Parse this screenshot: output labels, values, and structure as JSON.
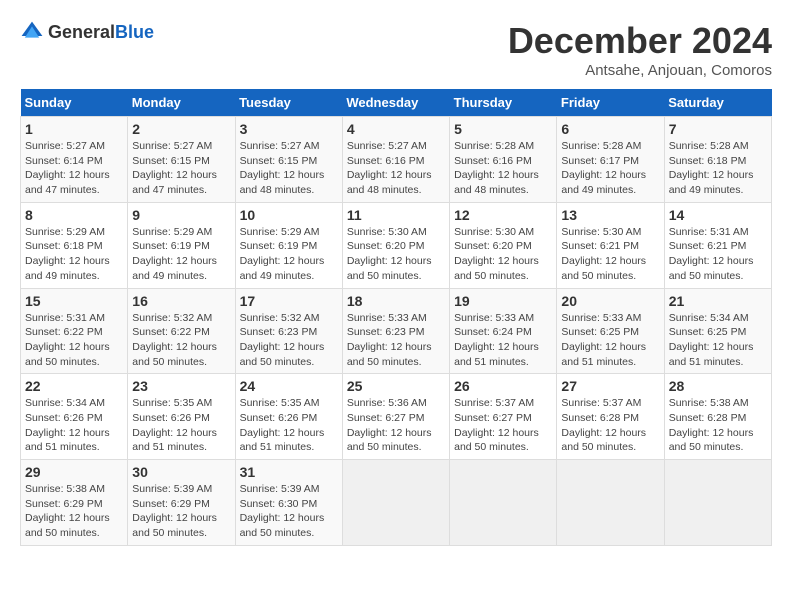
{
  "header": {
    "logo_general": "General",
    "logo_blue": "Blue",
    "title": "December 2024",
    "subtitle": "Antsahe, Anjouan, Comoros"
  },
  "days_of_week": [
    "Sunday",
    "Monday",
    "Tuesday",
    "Wednesday",
    "Thursday",
    "Friday",
    "Saturday"
  ],
  "weeks": [
    [
      {
        "day": 1,
        "sunrise": "5:27 AM",
        "sunset": "6:14 PM",
        "daylight": "12 hours and 47 minutes."
      },
      {
        "day": 2,
        "sunrise": "5:27 AM",
        "sunset": "6:15 PM",
        "daylight": "12 hours and 47 minutes."
      },
      {
        "day": 3,
        "sunrise": "5:27 AM",
        "sunset": "6:15 PM",
        "daylight": "12 hours and 48 minutes."
      },
      {
        "day": 4,
        "sunrise": "5:27 AM",
        "sunset": "6:16 PM",
        "daylight": "12 hours and 48 minutes."
      },
      {
        "day": 5,
        "sunrise": "5:28 AM",
        "sunset": "6:16 PM",
        "daylight": "12 hours and 48 minutes."
      },
      {
        "day": 6,
        "sunrise": "5:28 AM",
        "sunset": "6:17 PM",
        "daylight": "12 hours and 49 minutes."
      },
      {
        "day": 7,
        "sunrise": "5:28 AM",
        "sunset": "6:18 PM",
        "daylight": "12 hours and 49 minutes."
      }
    ],
    [
      {
        "day": 8,
        "sunrise": "5:29 AM",
        "sunset": "6:18 PM",
        "daylight": "12 hours and 49 minutes."
      },
      {
        "day": 9,
        "sunrise": "5:29 AM",
        "sunset": "6:19 PM",
        "daylight": "12 hours and 49 minutes."
      },
      {
        "day": 10,
        "sunrise": "5:29 AM",
        "sunset": "6:19 PM",
        "daylight": "12 hours and 49 minutes."
      },
      {
        "day": 11,
        "sunrise": "5:30 AM",
        "sunset": "6:20 PM",
        "daylight": "12 hours and 50 minutes."
      },
      {
        "day": 12,
        "sunrise": "5:30 AM",
        "sunset": "6:20 PM",
        "daylight": "12 hours and 50 minutes."
      },
      {
        "day": 13,
        "sunrise": "5:30 AM",
        "sunset": "6:21 PM",
        "daylight": "12 hours and 50 minutes."
      },
      {
        "day": 14,
        "sunrise": "5:31 AM",
        "sunset": "6:21 PM",
        "daylight": "12 hours and 50 minutes."
      }
    ],
    [
      {
        "day": 15,
        "sunrise": "5:31 AM",
        "sunset": "6:22 PM",
        "daylight": "12 hours and 50 minutes."
      },
      {
        "day": 16,
        "sunrise": "5:32 AM",
        "sunset": "6:22 PM",
        "daylight": "12 hours and 50 minutes."
      },
      {
        "day": 17,
        "sunrise": "5:32 AM",
        "sunset": "6:23 PM",
        "daylight": "12 hours and 50 minutes."
      },
      {
        "day": 18,
        "sunrise": "5:33 AM",
        "sunset": "6:23 PM",
        "daylight": "12 hours and 50 minutes."
      },
      {
        "day": 19,
        "sunrise": "5:33 AM",
        "sunset": "6:24 PM",
        "daylight": "12 hours and 51 minutes."
      },
      {
        "day": 20,
        "sunrise": "5:33 AM",
        "sunset": "6:25 PM",
        "daylight": "12 hours and 51 minutes."
      },
      {
        "day": 21,
        "sunrise": "5:34 AM",
        "sunset": "6:25 PM",
        "daylight": "12 hours and 51 minutes."
      }
    ],
    [
      {
        "day": 22,
        "sunrise": "5:34 AM",
        "sunset": "6:26 PM",
        "daylight": "12 hours and 51 minutes."
      },
      {
        "day": 23,
        "sunrise": "5:35 AM",
        "sunset": "6:26 PM",
        "daylight": "12 hours and 51 minutes."
      },
      {
        "day": 24,
        "sunrise": "5:35 AM",
        "sunset": "6:26 PM",
        "daylight": "12 hours and 51 minutes."
      },
      {
        "day": 25,
        "sunrise": "5:36 AM",
        "sunset": "6:27 PM",
        "daylight": "12 hours and 50 minutes."
      },
      {
        "day": 26,
        "sunrise": "5:37 AM",
        "sunset": "6:27 PM",
        "daylight": "12 hours and 50 minutes."
      },
      {
        "day": 27,
        "sunrise": "5:37 AM",
        "sunset": "6:28 PM",
        "daylight": "12 hours and 50 minutes."
      },
      {
        "day": 28,
        "sunrise": "5:38 AM",
        "sunset": "6:28 PM",
        "daylight": "12 hours and 50 minutes."
      }
    ],
    [
      {
        "day": 29,
        "sunrise": "5:38 AM",
        "sunset": "6:29 PM",
        "daylight": "12 hours and 50 minutes."
      },
      {
        "day": 30,
        "sunrise": "5:39 AM",
        "sunset": "6:29 PM",
        "daylight": "12 hours and 50 minutes."
      },
      {
        "day": 31,
        "sunrise": "5:39 AM",
        "sunset": "6:30 PM",
        "daylight": "12 hours and 50 minutes."
      },
      null,
      null,
      null,
      null
    ]
  ]
}
